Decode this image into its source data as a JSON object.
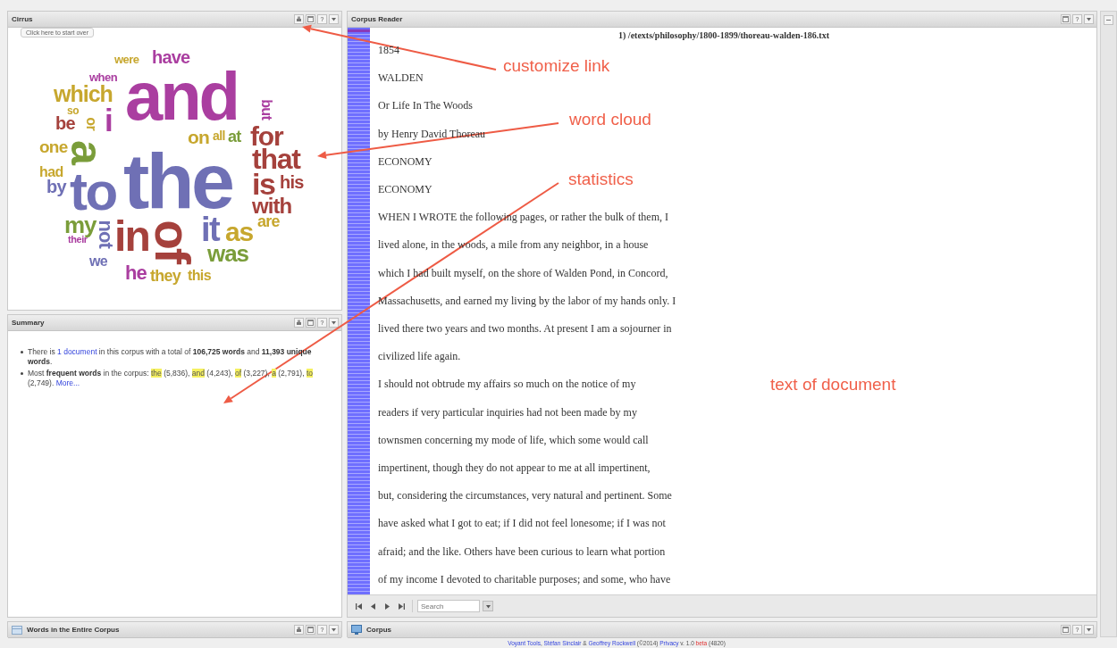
{
  "cirrus": {
    "title": "Cirrus",
    "tools": [
      {
        "kind": "export"
      },
      {
        "kind": "window"
      },
      {
        "kind": "help",
        "label": "?"
      },
      {
        "kind": "menu"
      }
    ],
    "tooltip": "Click here to start over",
    "words": [
      {
        "text": "were",
        "color": "#c7a72e"
      },
      {
        "text": "have",
        "color": "#aa3ea0"
      },
      {
        "text": "when",
        "color": "#aa3ea0"
      },
      {
        "text": "which",
        "color": "#c7a72e"
      },
      {
        "text": "so",
        "color": "#c7a72e"
      },
      {
        "text": "be",
        "color": "#a5413c"
      },
      {
        "text": "or",
        "color": "#c7a72e"
      },
      {
        "text": "i",
        "color": "#aa3ea0"
      },
      {
        "text": "and",
        "color": "#aa3ea0"
      },
      {
        "text": "but",
        "color": "#aa3ea0"
      },
      {
        "text": "one",
        "color": "#c7a72e"
      },
      {
        "text": "a",
        "color": "#7a9d3a"
      },
      {
        "text": "on",
        "color": "#c7a72e"
      },
      {
        "text": "all",
        "color": "#c7a72e"
      },
      {
        "text": "at",
        "color": "#7a9d3a"
      },
      {
        "text": "for",
        "color": "#a5413c"
      },
      {
        "text": "had",
        "color": "#c7a72e"
      },
      {
        "text": "by",
        "color": "#6f70b5"
      },
      {
        "text": "to",
        "color": "#6f70b5"
      },
      {
        "text": "the",
        "color": "#6f70b5"
      },
      {
        "text": "that",
        "color": "#a5413c"
      },
      {
        "text": "is",
        "color": "#a5413c"
      },
      {
        "text": "his",
        "color": "#a5413c"
      },
      {
        "text": "with",
        "color": "#a5413c"
      },
      {
        "text": "my",
        "color": "#7a9d3a"
      },
      {
        "text": "their",
        "color": "#aa3ea0"
      },
      {
        "text": "not",
        "color": "#6f70b5"
      },
      {
        "text": "in",
        "color": "#a5413c"
      },
      {
        "text": "we",
        "color": "#6f70b5"
      },
      {
        "text": "of",
        "color": "#a5413c"
      },
      {
        "text": "it",
        "color": "#6f70b5"
      },
      {
        "text": "as",
        "color": "#c7a72e"
      },
      {
        "text": "are",
        "color": "#c7a72e"
      },
      {
        "text": "was",
        "color": "#7a9d3a"
      },
      {
        "text": "he",
        "color": "#aa3ea0"
      },
      {
        "text": "they",
        "color": "#c7a72e"
      },
      {
        "text": "this",
        "color": "#c7a72e"
      }
    ]
  },
  "summary": {
    "title": "Summary",
    "tools": [
      {
        "kind": "export"
      },
      {
        "kind": "window"
      },
      {
        "kind": "help",
        "label": "?"
      },
      {
        "kind": "menu"
      }
    ],
    "items": [
      [
        {
          "kind": "plain",
          "text": "There is "
        },
        {
          "kind": "link",
          "text": "1 document"
        },
        {
          "kind": "plain",
          "text": " in this corpus with a total of "
        },
        {
          "kind": "bold",
          "text": "106,725 words"
        },
        {
          "kind": "plain",
          "text": " and "
        },
        {
          "kind": "bold",
          "text": "11,393 unique words"
        },
        {
          "kind": "plain",
          "text": "."
        }
      ],
      [
        {
          "kind": "plain",
          "text": "Most "
        },
        {
          "kind": "bold",
          "text": "frequent words"
        },
        {
          "kind": "plain",
          "text": " in the corpus: "
        },
        {
          "kind": "term",
          "text": "the"
        },
        {
          "kind": "plain",
          "text": " (5,836), "
        },
        {
          "kind": "term",
          "text": "and"
        },
        {
          "kind": "plain",
          "text": " (4,243), "
        },
        {
          "kind": "term",
          "text": "of"
        },
        {
          "kind": "plain",
          "text": " (3,227), "
        },
        {
          "kind": "term",
          "text": "a"
        },
        {
          "kind": "plain",
          "text": " (2,791), "
        },
        {
          "kind": "term",
          "text": "to"
        },
        {
          "kind": "plain",
          "text": " (2,749). "
        },
        {
          "kind": "link",
          "text": "More..."
        }
      ]
    ]
  },
  "words_panel": {
    "title": "Words in the Entire Corpus",
    "tools": [
      {
        "kind": "export"
      },
      {
        "kind": "window"
      },
      {
        "kind": "help",
        "label": "?"
      },
      {
        "kind": "menu"
      }
    ]
  },
  "reader": {
    "title": "Corpus Reader",
    "tools": [
      {
        "kind": "window"
      },
      {
        "kind": "help",
        "label": "?"
      },
      {
        "kind": "menu"
      }
    ],
    "document_title": "1) /etexts/philosophy/1800-1899/thoreau-walden-186.txt",
    "lines": [
      "1854",
      "WALDEN",
      "Or Life In The Woods",
      "by Henry David Thoreau",
      "ECONOMY",
      "ECONOMY",
      "WHEN I WROTE the following pages, or rather the bulk of them, I",
      "lived alone, in the woods, a mile from any neighbor, in a house",
      "which I had built myself, on the shore of Walden Pond, in Concord,",
      "Massachusetts, and earned my living by the labor of my hands only. I",
      "lived there two years and two months. At present I am a sojourner in",
      "civilized life again.",
      "I should not obtrude my affairs so much on the notice of my",
      "readers if very particular inquiries had not been made by my",
      "townsmen concerning my mode of life, which some would call",
      "impertinent, though they do not appear to me at all impertinent,",
      "but, considering the circumstances, very natural and pertinent. Some",
      "have asked what I got to eat; if I did not feel lonesome; if I was not",
      "afraid; and the like. Others have been curious to learn what portion",
      "of my income I devoted to charitable purposes; and some, who have"
    ],
    "toolbar": {
      "buttons": [
        {
          "kind": "first"
        },
        {
          "kind": "prev"
        },
        {
          "kind": "next"
        },
        {
          "kind": "last"
        }
      ],
      "search": {
        "placeholder": "Search"
      }
    }
  },
  "corpus_panel": {
    "title": "Corpus",
    "tools": [
      {
        "kind": "window"
      },
      {
        "kind": "help",
        "label": "?"
      },
      {
        "kind": "menu"
      }
    ]
  },
  "footer": [
    {
      "kind": "link",
      "text": "Voyant Tools"
    },
    {
      "kind": "plain",
      "text": ", "
    },
    {
      "kind": "link",
      "text": "Stéfan Sinclair"
    },
    {
      "kind": "plain",
      "text": " & "
    },
    {
      "kind": "link",
      "text": "Geoffrey Rockwell"
    },
    {
      "kind": "plain",
      "text": " (©2014) "
    },
    {
      "kind": "link",
      "text": "Privacy"
    },
    {
      "kind": "plain",
      "text": " v. 1.0 "
    },
    {
      "kind": "alert",
      "text": "beta"
    },
    {
      "kind": "plain",
      "text": " (4820)"
    }
  ],
  "annotations": [
    {
      "kind": "arrow-label",
      "text": "customize link"
    },
    {
      "kind": "arrow-label",
      "text": "word cloud"
    },
    {
      "kind": "arrow-label",
      "text": "statistics"
    },
    {
      "kind": "label",
      "text": "text of document"
    }
  ]
}
